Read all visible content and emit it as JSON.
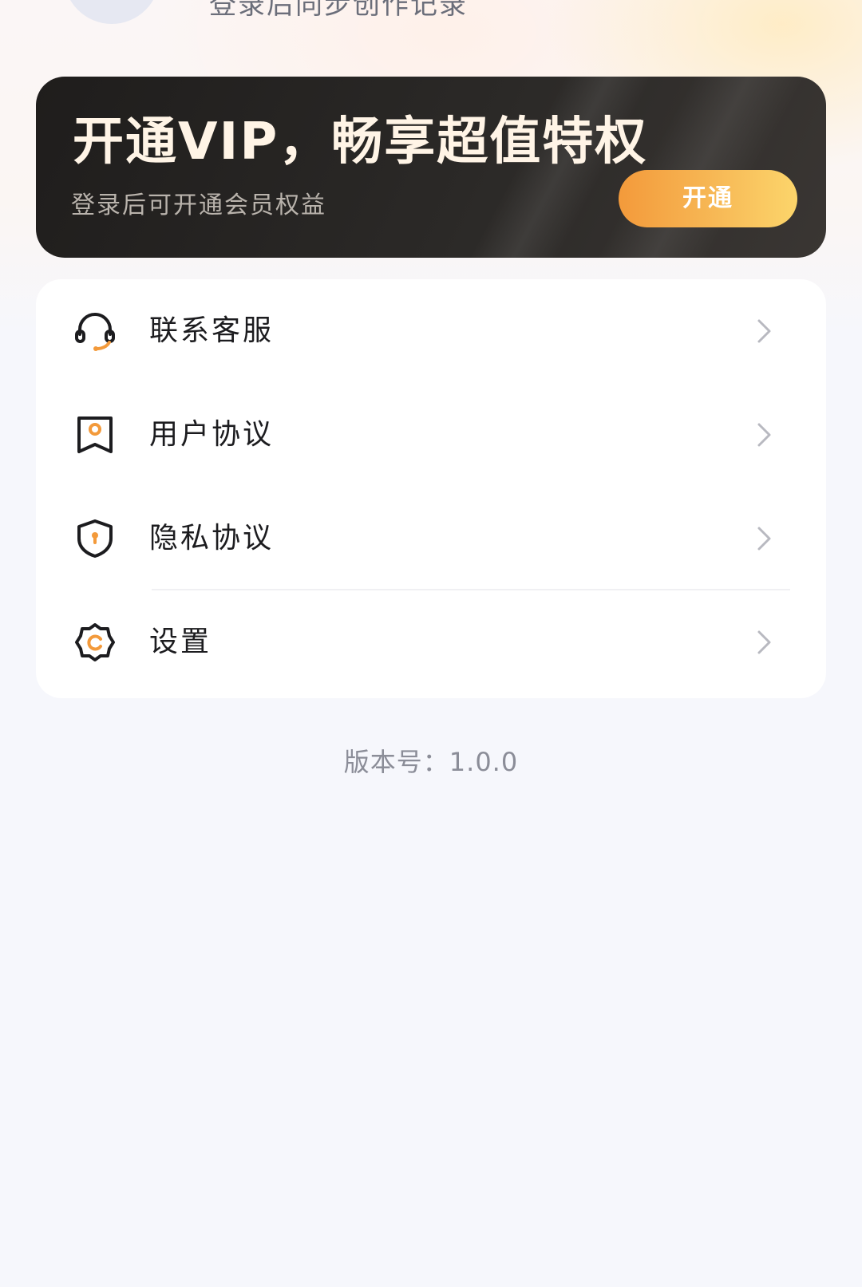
{
  "header": {
    "login_hint": "登录后同步创作记录"
  },
  "vip_banner": {
    "title": "开通VIP，畅享超值特权",
    "subtitle": "登录后可开通会员权益",
    "button_label": "开通",
    "accent_color": "#f39a3b"
  },
  "menu": {
    "items": [
      {
        "label": "联系客服",
        "icon": "headset-icon"
      },
      {
        "label": "用户协议",
        "icon": "agreement-icon"
      },
      {
        "label": "隐私协议",
        "icon": "shield-lock-icon"
      },
      {
        "label": "设置",
        "icon": "gear-icon"
      }
    ]
  },
  "footer": {
    "version": "版本号：1.0.0"
  }
}
